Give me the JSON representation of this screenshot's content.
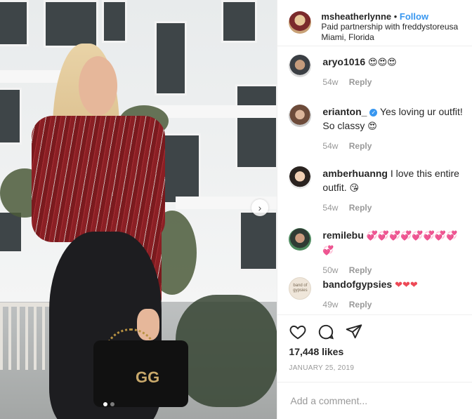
{
  "header": {
    "username": "msheatherlynne",
    "separator": "•",
    "follow_label": "Follow",
    "partnership": "Paid partnership with freddystoreusa",
    "location": "Miami, Florida"
  },
  "photo": {
    "next_icon": "chevron-right-icon",
    "logo_text": "GG"
  },
  "comments": [
    {
      "user": "aryo1016",
      "text": "",
      "emoji": "😍😍😍",
      "age": "54w",
      "reply": "Reply"
    },
    {
      "user": "erianton_",
      "verified": true,
      "text": "Yes loving ur outfit! So classy",
      "emoji": "😍",
      "age": "54w",
      "reply": "Reply"
    },
    {
      "user": "amberhuanng",
      "text": "I love this entire outfit.",
      "emoji": "😘",
      "age": "54w",
      "reply": "Reply"
    },
    {
      "user": "remilebu",
      "text": "",
      "emoji": "💞💞💞💞💞💞💞💞💞",
      "age": "50w",
      "reply": "Reply"
    },
    {
      "user": "bandofgypsies",
      "text": "",
      "emoji": "❤❤❤",
      "age": "49w",
      "reply": "Reply"
    }
  ],
  "bandofgypsies_avatar_text": "band of gypsies",
  "actions": {
    "like_icon": "heart-icon",
    "comment_icon": "comment-bubble-icon",
    "share_icon": "paper-plane-icon"
  },
  "likes": "17,448 likes",
  "date": "JANUARY 25, 2019",
  "add_comment": {
    "placeholder": "Add a comment..."
  },
  "colors": {
    "accent": "#3897f0",
    "heart": "#ed4956",
    "muted": "#999999"
  }
}
